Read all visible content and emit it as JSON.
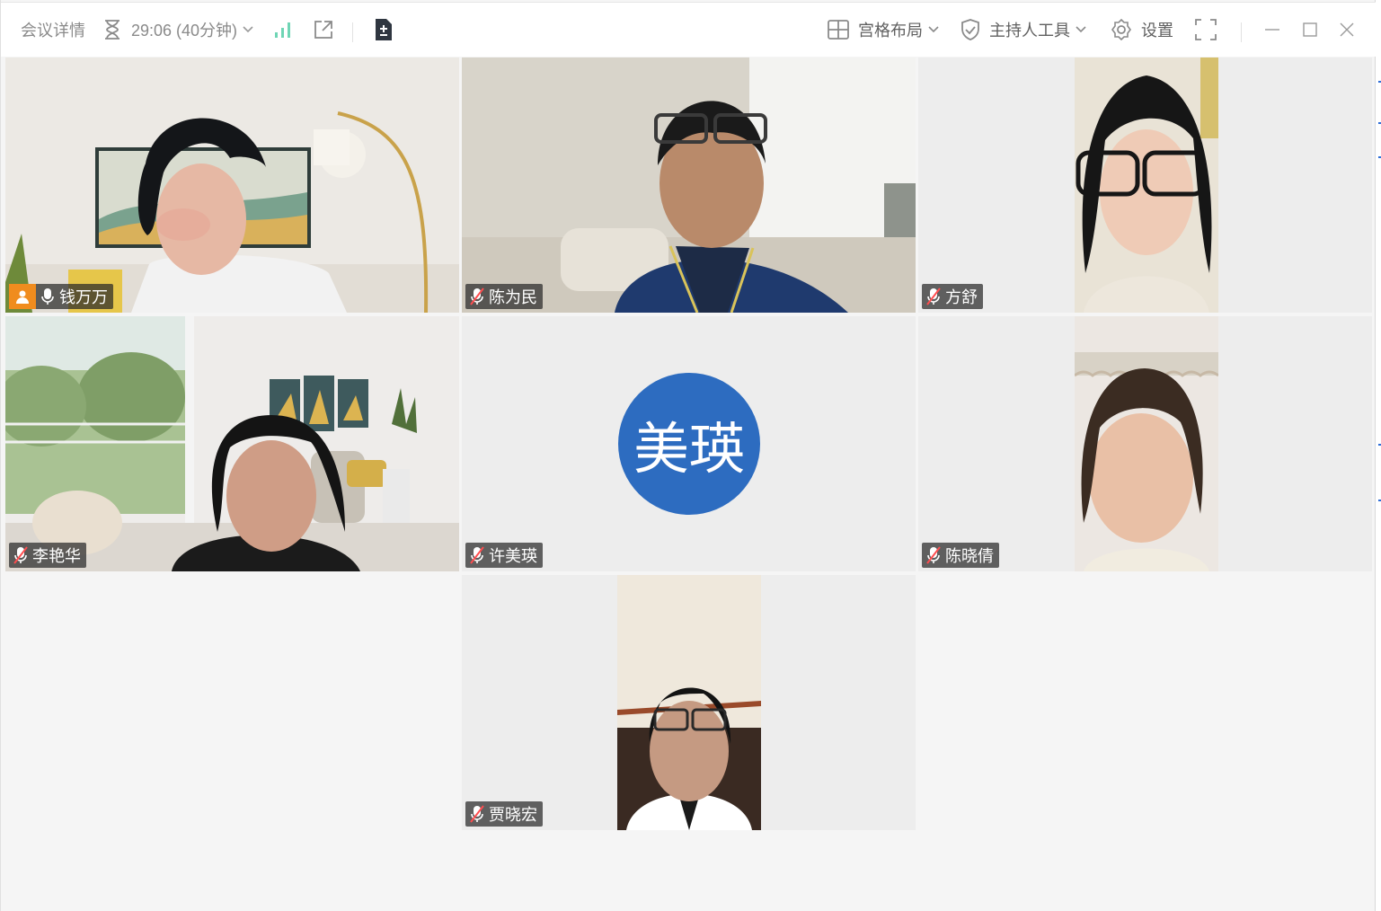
{
  "window": {
    "accent_color": "#2d6cc0",
    "host_color": "#f08c1e"
  },
  "topbar": {
    "meeting_details": "会议详情",
    "timer": "29:06 (40分钟)",
    "layout_label": "宫格布局",
    "host_tools_label": "主持人工具",
    "settings_label": "设置",
    "icons": [
      "hourglass-icon",
      "chevron-down-icon",
      "signal-icon",
      "share-out-icon",
      "document-icon",
      "grid-layout-icon",
      "shield-check-icon",
      "gear-icon",
      "fullscreen-icon",
      "minimize-icon",
      "maximize-icon",
      "close-icon"
    ]
  },
  "participants": [
    {
      "name": "钱万万",
      "muted": false,
      "is_host": true
    },
    {
      "name": "陈为民",
      "muted": true
    },
    {
      "name": "方舒",
      "muted": true
    },
    {
      "name": "李艳华",
      "muted": true
    },
    {
      "name": "许美瑛",
      "muted": true,
      "avatar_text": "美瑛",
      "camera_off": true
    },
    {
      "name": "陈晓倩",
      "muted": true
    },
    {
      "name": "贾晓宏",
      "muted": true
    }
  ]
}
